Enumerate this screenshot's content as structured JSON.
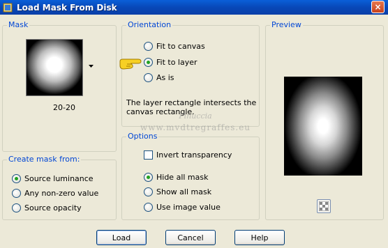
{
  "window": {
    "title": "Load Mask From Disk",
    "close_label": "×"
  },
  "mask": {
    "legend": "Mask",
    "thumbnail_name": "20-20",
    "dropdown_icon": "chevron-down-icon"
  },
  "orientation": {
    "legend": "Orientation",
    "options": [
      "Fit to canvas",
      "Fit to layer",
      "As is"
    ],
    "selected": "Fit to layer",
    "info": [
      "The layer rectangle intersects the",
      "canvas rectangle."
    ]
  },
  "create_mask_from": {
    "legend": "Create mask from:",
    "options": [
      "Source luminance",
      "Any non-zero value",
      "Source opacity"
    ],
    "selected": "Source luminance"
  },
  "options": {
    "legend": "Options",
    "invert_label": "Invert transparency",
    "invert_checked": false,
    "radio_options": [
      "Hide all mask",
      "Show all mask",
      "Use image value"
    ],
    "selected": "Hide all mask"
  },
  "preview": {
    "legend": "Preview",
    "toggle_icon": "checkerboard-icon"
  },
  "buttons": {
    "load": "Load",
    "cancel": "Cancel",
    "help": "Help"
  },
  "watermark": {
    "line1": "Pinuccia",
    "line2": "www.mvdtregraffes.eu"
  },
  "colors": {
    "title_bar": "#0a5fd8",
    "legend_text": "#0046d5",
    "dialog_bg": "#ece9d8"
  }
}
